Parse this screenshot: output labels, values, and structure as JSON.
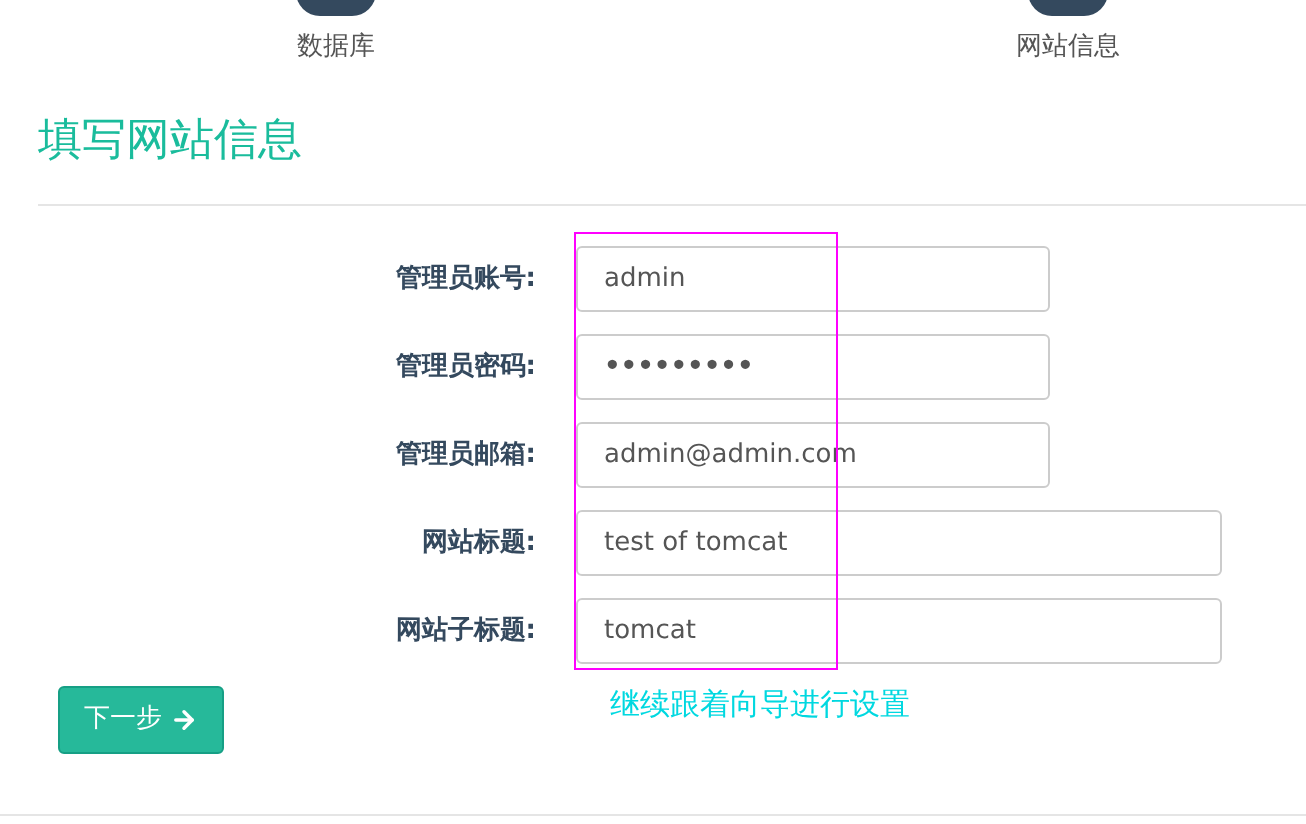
{
  "steps": [
    {
      "label": "数据库"
    },
    {
      "label": "网站信息"
    }
  ],
  "title": "填写网站信息",
  "fields": [
    {
      "label": "管理员账号:",
      "value": "admin",
      "kind": "text",
      "wide": false
    },
    {
      "label": "管理员密码:",
      "value": "•••••••••",
      "kind": "password",
      "wide": false
    },
    {
      "label": "管理员邮箱:",
      "value": "admin@admin.com",
      "kind": "text",
      "wide": false
    },
    {
      "label": "网站标题:",
      "value": "test of tomcat",
      "kind": "text",
      "wide": true
    },
    {
      "label": "网站子标题:",
      "value": "tomcat",
      "kind": "text",
      "wide": true
    }
  ],
  "next_button": "下一步",
  "annotation": "继续跟着向导进行设置"
}
